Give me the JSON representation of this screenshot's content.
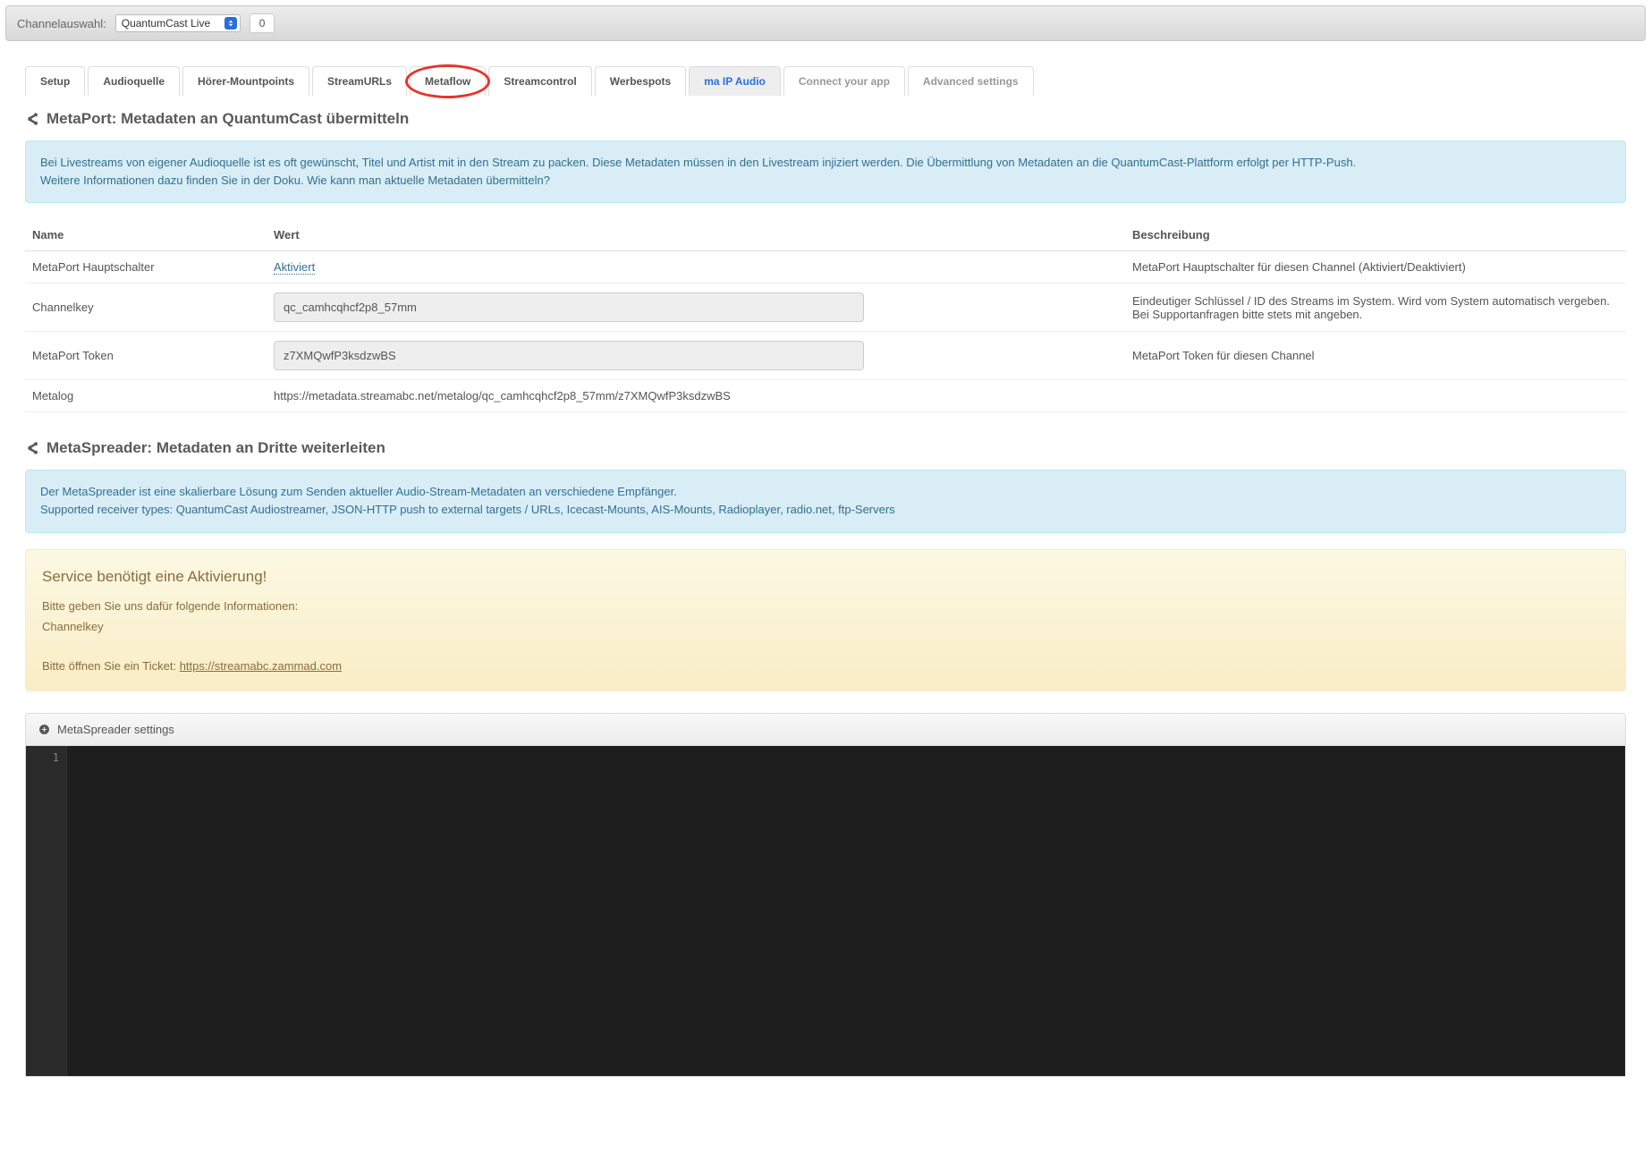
{
  "topbar": {
    "label": "Channelauswahl:",
    "selected_channel": "QuantumCast Live",
    "count": "0"
  },
  "tabs": [
    {
      "label": "Setup"
    },
    {
      "label": "Audioquelle"
    },
    {
      "label": "Hörer-Mountpoints"
    },
    {
      "label": "StreamURLs"
    },
    {
      "label": "Metaflow"
    },
    {
      "label": "Streamcontrol"
    },
    {
      "label": "Werbespots"
    },
    {
      "label": "ma IP Audio"
    },
    {
      "label": "Connect your app"
    },
    {
      "label": "Advanced settings"
    }
  ],
  "metaport": {
    "heading": "MetaPort: Metadaten an QuantumCast übermitteln",
    "info_line1": "Bei Livestreams von eigener Audioquelle ist es oft gewünscht, Titel und Artist mit in den Stream zu packen. Diese Metadaten müssen in den Livestream injiziert werden. Die Übermittlung von Metadaten an die QuantumCast-Plattform erfolgt per HTTP-Push.",
    "info_line2a": "Weitere Informationen dazu finden Sie in der Doku. ",
    "info_line2_link": "Wie kann man aktuelle Metadaten übermitteln?",
    "columns": {
      "name": "Name",
      "wert": "Wert",
      "beschreibung": "Beschreibung"
    },
    "rows": {
      "hauptschalter": {
        "name": "MetaPort Hauptschalter",
        "value": "Aktiviert",
        "desc": "MetaPort Hauptschalter für diesen Channel (Aktiviert/Deaktiviert)"
      },
      "channelkey": {
        "name": "Channelkey",
        "value": "qc_camhcqhcf2p8_57mm",
        "desc": "Eindeutiger Schlüssel / ID des Streams im System. Wird vom System automatisch vergeben. Bei Supportanfragen bitte stets mit angeben."
      },
      "token": {
        "name": "MetaPort Token",
        "value": "z7XMQwfP3ksdzwBS",
        "desc": "MetaPort Token für diesen Channel"
      },
      "metalog": {
        "name": "Metalog",
        "value": "https://metadata.streamabc.net/metalog/qc_camhcqhcf2p8_57mm/z7XMQwfP3ksdzwBS",
        "desc": ""
      }
    }
  },
  "metaspreader": {
    "heading": "MetaSpreader: Metadaten an Dritte weiterleiten",
    "info_line1": "Der MetaSpreader ist eine skalierbare Lösung zum Senden aktueller Audio-Stream-Metadaten an verschiedene Empfänger.",
    "info_line2": "Supported receiver types: QuantumCast Audiostreamer, JSON-HTTP push to external targets / URLs, Icecast-Mounts, AIS-Mounts, Radioplayer, radio.net, ftp-Servers"
  },
  "warning": {
    "title": "Service benötigt eine Aktivierung!",
    "line1": "Bitte geben Sie uns dafür folgende Informationen:",
    "line2": "Channelkey",
    "line3_prefix": "Bitte öffnen Sie ein Ticket: ",
    "line3_link": "https://streamabc.zammad.com"
  },
  "settings_panel": {
    "title": "MetaSpreader settings",
    "gutter_line": "1"
  }
}
